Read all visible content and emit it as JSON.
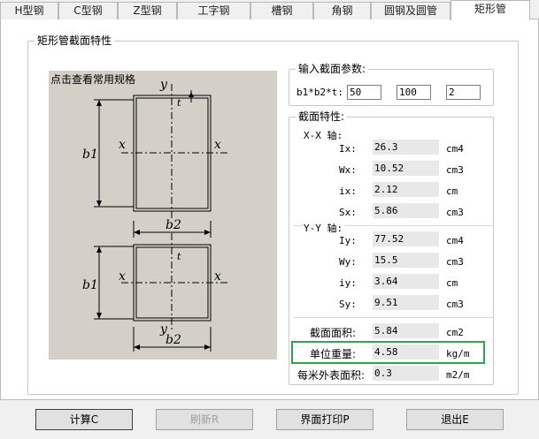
{
  "tabs": [
    "H型钢",
    "C型钢",
    "Z型钢",
    "工字钢",
    "槽钢",
    "角钢",
    "圆钢及圆管",
    "矩形管"
  ],
  "section_group": "矩形管截面特性",
  "drawing": {
    "note": "点击查看常用规格",
    "top": {
      "y": "y",
      "t": "t",
      "b1": "b1",
      "x_left": "x",
      "x_right": "x",
      "b2": "b2"
    },
    "bottom": {
      "y": "y",
      "t": "t",
      "b1": "b1",
      "x_left": "x",
      "x_right": "x",
      "b2": "b2"
    }
  },
  "inputs": {
    "title": "输入截面参数:",
    "label": "b1*b2*t:",
    "b1": "50",
    "b2": "100",
    "t": "2"
  },
  "properties": {
    "title": "截面特性:",
    "xx_title": "X-X 轴:",
    "yy_title": "Y-Y 轴:",
    "xx": [
      {
        "label": "Ix:",
        "value": "26.3",
        "unit": "cm4"
      },
      {
        "label": "Wx:",
        "value": "10.52",
        "unit": "cm3"
      },
      {
        "label": "ix:",
        "value": "2.12",
        "unit": "cm"
      },
      {
        "label": "Sx:",
        "value": "5.86",
        "unit": "cm3"
      }
    ],
    "yy": [
      {
        "label": "Iy:",
        "value": "77.52",
        "unit": "cm4"
      },
      {
        "label": "Wy:",
        "value": "15.5",
        "unit": "cm3"
      },
      {
        "label": "iy:",
        "value": "3.64",
        "unit": "cm"
      },
      {
        "label": "Sy:",
        "value": "9.51",
        "unit": "cm3"
      }
    ],
    "area": {
      "label": "截面面积:",
      "value": "5.84",
      "unit": "cm2"
    },
    "weight": {
      "label": "单位重量:",
      "value": "4.58",
      "unit": "kg/m"
    },
    "surface": {
      "label": "每米外表面积:",
      "value": "0.3",
      "unit": "m2/m"
    }
  },
  "buttons": {
    "calc": "计算C",
    "refresh": "刷新R",
    "print": "界面打印P",
    "exit": "退出E"
  },
  "colors": {
    "highlight": "#2ea44f",
    "drawing_bg": "#d4d0c8"
  }
}
